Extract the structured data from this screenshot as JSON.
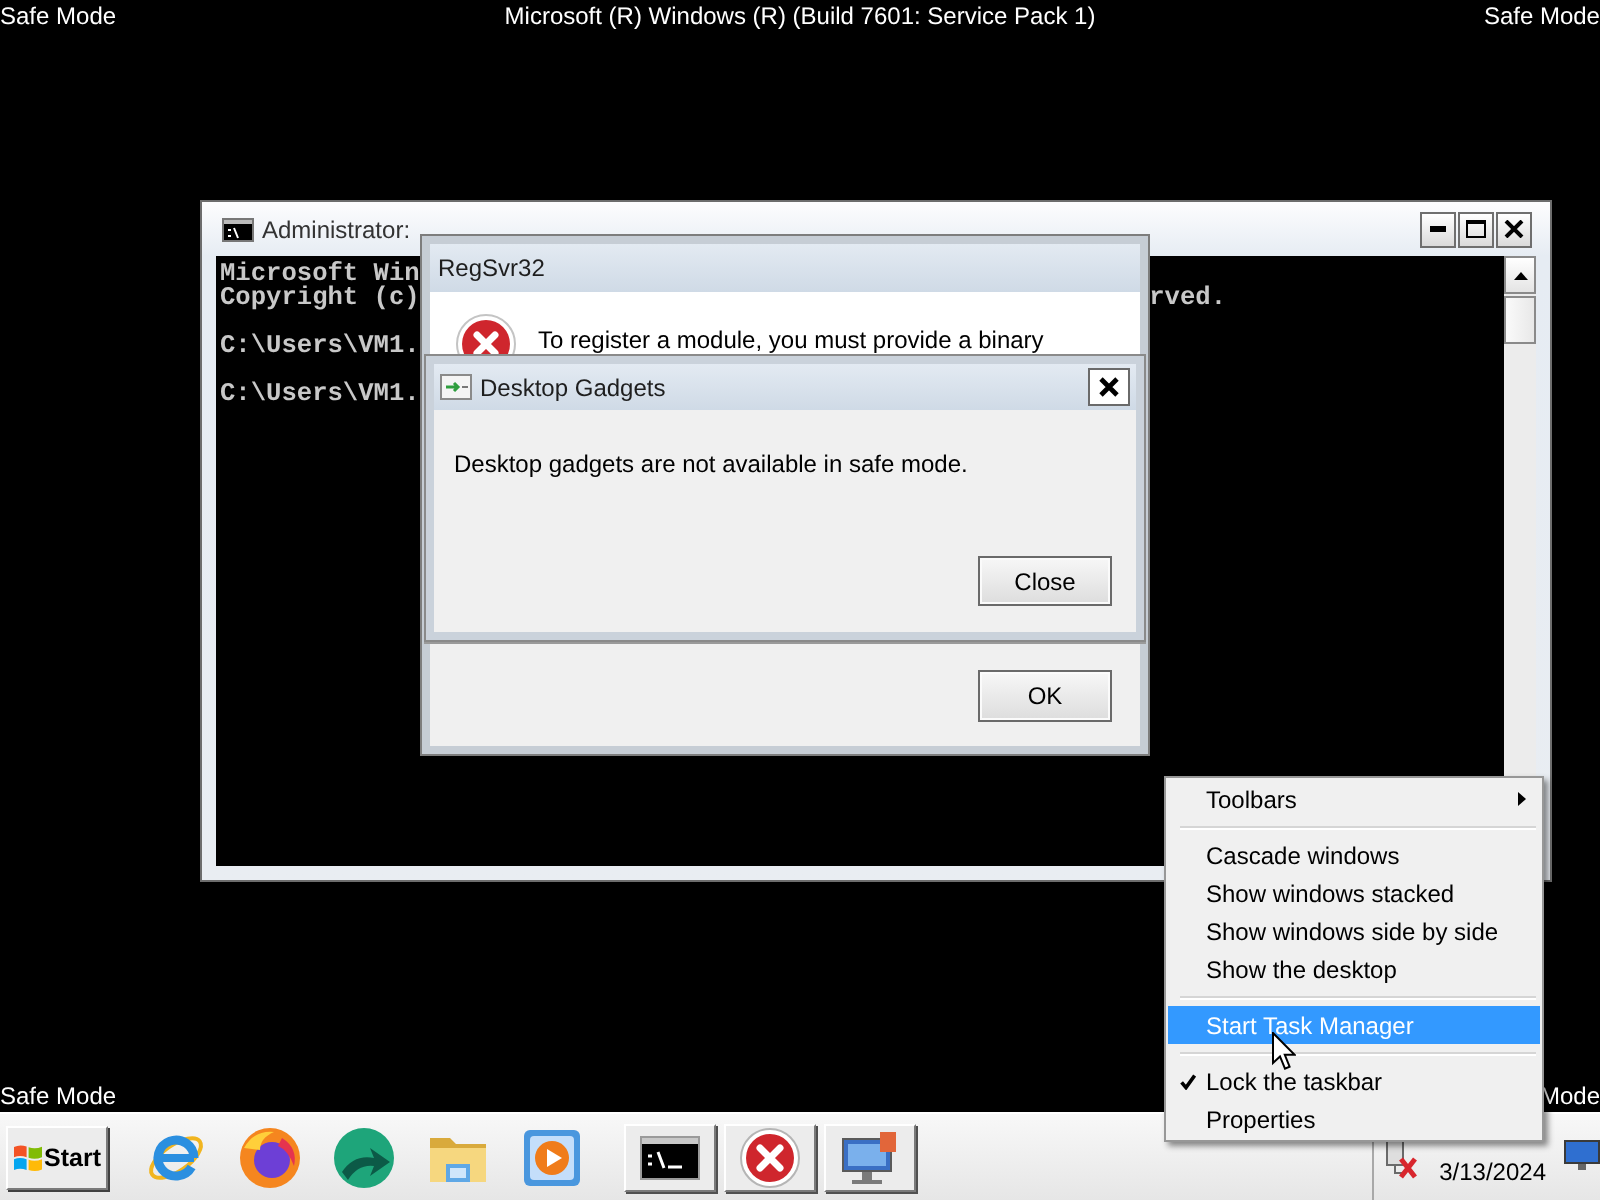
{
  "banners": {
    "top": [
      "Safe Mode",
      "Microsoft (R) Windows (R) (Build 7601: Service Pack 1)",
      "Safe Mode"
    ],
    "bottom": [
      "Safe Mode",
      "Mode"
    ]
  },
  "console_window": {
    "title": "Administrator:",
    "output_blocks": [
      [
        {
          "text": "Microsoft Win"
        },
        {
          "text": "Copyright (c)",
          "tail": "rved."
        }
      ],
      [
        {
          "text": "C:\\Users\\VM1."
        }
      ],
      [
        {
          "text": "C:\\Users\\VM1."
        }
      ]
    ]
  },
  "regsvr_dialog": {
    "title": "RegSvr32",
    "message": "To register a module, you must provide a binary",
    "buttons": [
      "OK"
    ]
  },
  "gadgets_dialog": {
    "title": "Desktop Gadgets",
    "message": "Desktop gadgets are not available in safe mode.",
    "buttons": [
      "Close"
    ]
  },
  "context_menu": {
    "groups": [
      [
        {
          "label": "Toolbars",
          "kind": "submenu",
          "checked": false,
          "selected": false
        }
      ],
      [
        {
          "label": "Cascade windows",
          "kind": "command",
          "checked": false,
          "selected": false
        },
        {
          "label": "Show windows stacked",
          "kind": "command",
          "checked": false,
          "selected": false
        },
        {
          "label": "Show windows side by side",
          "kind": "command",
          "checked": false,
          "selected": false
        },
        {
          "label": "Show the desktop",
          "kind": "command",
          "checked": false,
          "selected": false
        }
      ],
      [
        {
          "label": "Start Task Manager",
          "kind": "command",
          "checked": false,
          "selected": true
        }
      ],
      [
        {
          "label": "Lock the taskbar",
          "kind": "command",
          "checked": true,
          "selected": false
        },
        {
          "label": "Properties",
          "kind": "command",
          "checked": false,
          "selected": false
        }
      ]
    ]
  },
  "taskbar": {
    "start_label": "Start",
    "pinned": [
      {
        "kind": "e-orbit"
      },
      {
        "kind": "swirl-globe"
      },
      {
        "kind": "circle-arrow"
      },
      {
        "kind": "folder"
      },
      {
        "kind": "play-tile"
      }
    ],
    "buttons": [
      {
        "kind": "terminal"
      },
      {
        "kind": "error"
      },
      {
        "kind": "monitor"
      }
    ],
    "tray": {
      "date": "3/13/2024"
    }
  }
}
